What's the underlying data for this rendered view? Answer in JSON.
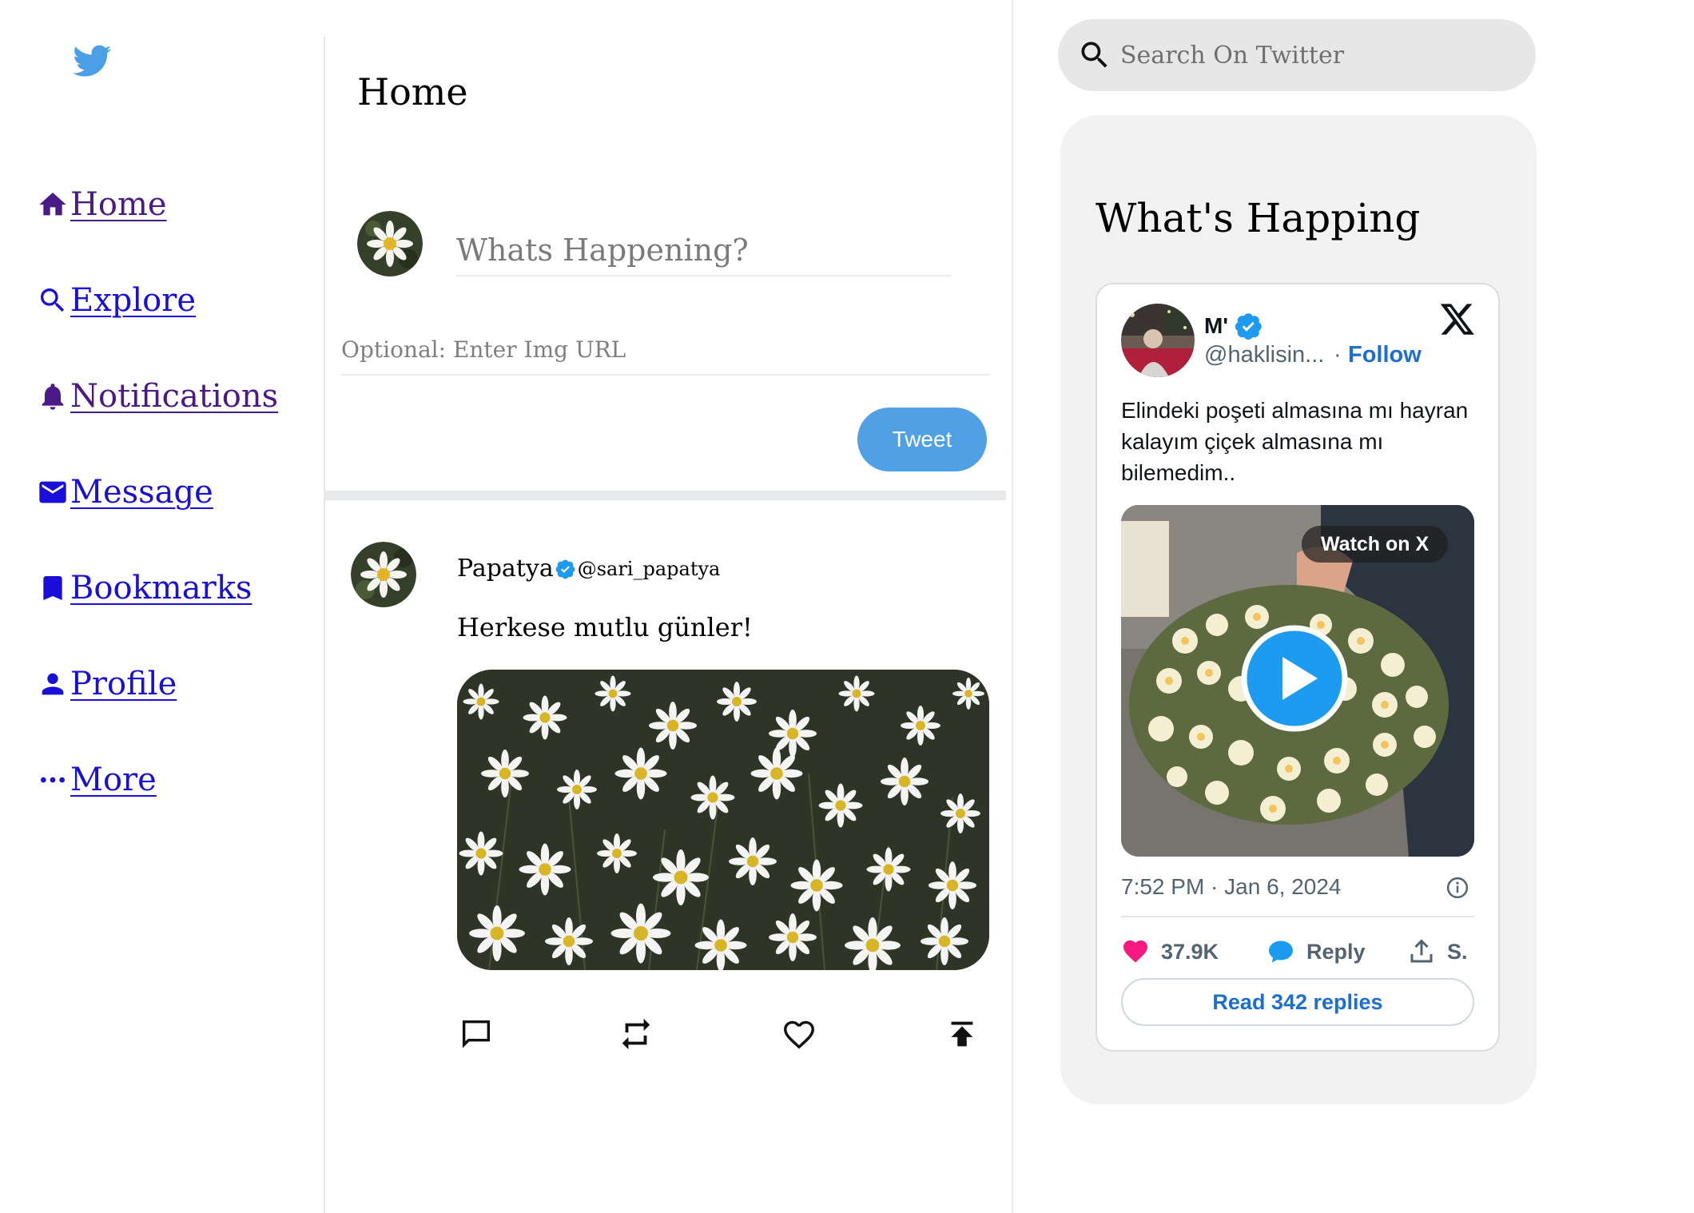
{
  "sidebar": {
    "logo": "twitter-bird-icon",
    "items": [
      {
        "label": "Home",
        "icon": "home-icon",
        "state": "visited"
      },
      {
        "label": "Explore",
        "icon": "search-icon",
        "state": "link"
      },
      {
        "label": "Notifications",
        "icon": "bell-icon",
        "state": "visited"
      },
      {
        "label": "Message",
        "icon": "mail-icon",
        "state": "link"
      },
      {
        "label": "Bookmarks",
        "icon": "bookmark-icon",
        "state": "link"
      },
      {
        "label": "Profile",
        "icon": "person-icon",
        "state": "link"
      },
      {
        "label": "More",
        "icon": "more-dots-icon",
        "state": "link"
      }
    ]
  },
  "main": {
    "title": "Home",
    "compose": {
      "placeholder": "Whats Happening?",
      "value": "",
      "img_url_placeholder": "Optional: Enter Img URL",
      "img_url_value": "",
      "tweet_button_label": "Tweet"
    },
    "post": {
      "author_name": "Papatya",
      "author_handle": "@sari_papatya",
      "text": "Herkese mutlu günler!",
      "actions": [
        "comment-icon",
        "retweet-icon",
        "like-heart-icon",
        "share-upload-icon"
      ]
    }
  },
  "right": {
    "search_placeholder": "Search On Twitter",
    "search_value": "",
    "trends_title": "What's Happing",
    "embed": {
      "name": "M'",
      "handle": "@haklisin...",
      "dot": "·",
      "follow_label": "Follow",
      "text": "Elindeki poşeti almasına mı hayran kalayım çiçek almasına mı bilemedim..",
      "watch_label": "Watch on X",
      "timestamp": "7:52 PM · Jan 6, 2024",
      "likes": "37.9K",
      "reply_label": "Reply",
      "share_label": "S.",
      "read_replies_label": "Read 342 replies"
    }
  },
  "colors": {
    "twitter_blue": "#50a0e6",
    "visited_link": "#4a1a86",
    "link": "#1a0fd8",
    "follow_blue": "#1d6ed1",
    "heart_pink": "#f91880",
    "verified_blue": "#1d9bf0"
  }
}
